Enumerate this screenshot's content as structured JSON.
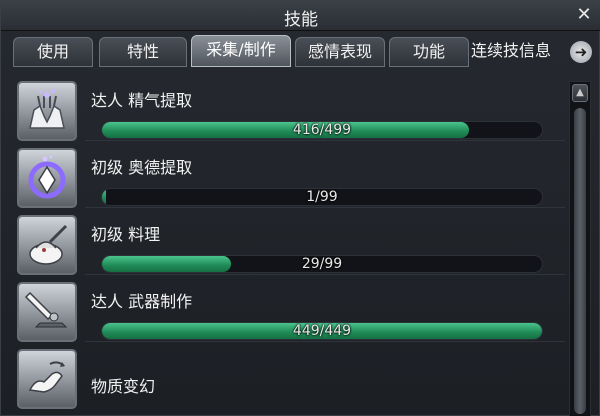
{
  "window": {
    "title": "技能",
    "close_icon": "close-icon"
  },
  "tabs": [
    {
      "label": "使用",
      "active": false
    },
    {
      "label": "特性",
      "active": false
    },
    {
      "label": "采集/制作",
      "active": true
    },
    {
      "label": "感情表现",
      "active": false
    },
    {
      "label": "功能",
      "active": false
    }
  ],
  "tab_more": {
    "label": "连续技信息",
    "arrow_icon": "arrow-right-icon"
  },
  "skills": [
    {
      "name": "达人 精气提取",
      "icon": "hands-sparkle-icon",
      "current": 416,
      "max": 499,
      "progress_text": "416/499"
    },
    {
      "name": "初级 奥德提取",
      "icon": "ring-crystal-icon",
      "current": 1,
      "max": 99,
      "progress_text": "1/99"
    },
    {
      "name": "初级 料理",
      "icon": "cooking-pot-icon",
      "current": 29,
      "max": 99,
      "progress_text": "29/99"
    },
    {
      "name": "达人 武器制作",
      "icon": "weapon-craft-icon",
      "current": 449,
      "max": 449,
      "progress_text": "449/449"
    },
    {
      "name": "物质变幻",
      "icon": "transmute-hand-icon"
    }
  ],
  "colors": {
    "bar_fill": "#24a066",
    "bar_bg": "#111318",
    "panel_bg": "#1c1f24"
  }
}
